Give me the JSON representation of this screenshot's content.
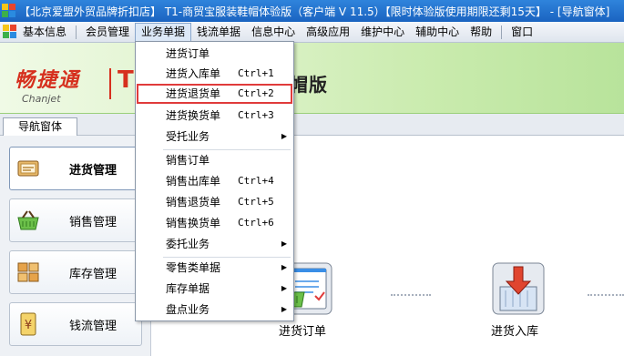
{
  "window": {
    "title": "【北京爱盟外贸品牌折扣店】 T1-商贸宝服装鞋帽体验版（客户端 V 11.5）【限时体验版使用期限还剩15天】 - [导航窗体]"
  },
  "menubar": {
    "items": [
      "基本信息",
      "会员管理",
      "业务单据",
      "钱流单据",
      "信息中心",
      "高级应用",
      "维护中心",
      "辅助中心",
      "帮助",
      "窗口"
    ],
    "active_index": 2
  },
  "banner": {
    "logo_cn": "畅捷通",
    "logo_en": "Chanjet",
    "logo_t": "T",
    "suffix": "帽版"
  },
  "tabs": {
    "nav": "导航窗体"
  },
  "sidebar": {
    "items": [
      {
        "label": "进货管理",
        "icon": "purchase-icon",
        "active": true
      },
      {
        "label": "销售管理",
        "icon": "basket-icon",
        "active": false
      },
      {
        "label": "库存管理",
        "icon": "warehouse-icon",
        "active": false
      },
      {
        "label": "钱流管理",
        "icon": "money-icon",
        "active": false
      }
    ]
  },
  "main": {
    "flow": [
      {
        "label": "进货订单",
        "icon": "order-doc-icon"
      },
      {
        "label": "进货入库",
        "icon": "stock-in-icon"
      }
    ]
  },
  "dropdown": {
    "items": [
      {
        "label": "进货订单",
        "shortcut": "",
        "submenu": false
      },
      {
        "label": "进货入库单",
        "shortcut": "Ctrl+1",
        "submenu": false
      },
      {
        "label": "进货退货单",
        "shortcut": "Ctrl+2",
        "submenu": false,
        "highlighted": true
      },
      {
        "label": "进货换货单",
        "shortcut": "Ctrl+3",
        "submenu": false
      },
      {
        "label": "受托业务",
        "shortcut": "",
        "submenu": true
      },
      {
        "label": "销售订单",
        "shortcut": "",
        "submenu": false
      },
      {
        "label": "销售出库单",
        "shortcut": "Ctrl+4",
        "submenu": false
      },
      {
        "label": "销售退货单",
        "shortcut": "Ctrl+5",
        "submenu": false
      },
      {
        "label": "销售换货单",
        "shortcut": "Ctrl+6",
        "submenu": false
      },
      {
        "label": "委托业务",
        "shortcut": "",
        "submenu": true
      },
      {
        "label": "零售类单据",
        "shortcut": "",
        "submenu": true
      },
      {
        "label": "库存单据",
        "shortcut": "",
        "submenu": true
      },
      {
        "label": "盘点业务",
        "shortcut": "",
        "submenu": true
      }
    ]
  },
  "colors": {
    "titlebar": "#1a63c0",
    "highlight_border": "#e03b3b",
    "banner_green": "#c9ebad",
    "logo_red": "#d6301e"
  }
}
